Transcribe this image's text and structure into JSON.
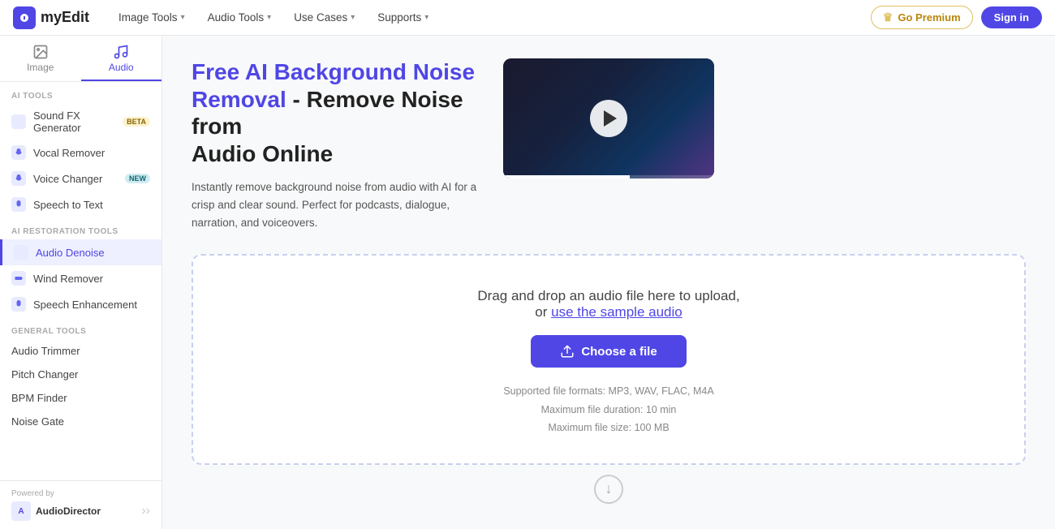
{
  "nav": {
    "logo_text": "myEdit",
    "items": [
      {
        "label": "Image Tools",
        "id": "image-tools"
      },
      {
        "label": "Audio Tools",
        "id": "audio-tools"
      },
      {
        "label": "Use Cases",
        "id": "use-cases"
      },
      {
        "label": "Supports",
        "id": "supports"
      }
    ],
    "premium_label": "Go Premium",
    "signin_label": "Sign in"
  },
  "sidebar": {
    "tab_image": "Image",
    "tab_audio": "Audio",
    "ai_tools_label": "AI TOOLS",
    "ai_restoration_label": "AI RESTORATION TOOLS",
    "general_tools_label": "GENERAL TOOLS",
    "items_ai": [
      {
        "label": "Sound FX Generator",
        "badge": "BETA",
        "badge_type": "beta"
      },
      {
        "label": "Vocal Remover",
        "badge": "",
        "badge_type": ""
      },
      {
        "label": "Voice Changer",
        "badge": "NEW",
        "badge_type": "new"
      },
      {
        "label": "Speech to Text",
        "badge": "",
        "badge_type": ""
      }
    ],
    "items_restoration": [
      {
        "label": "Audio Denoise",
        "active": true
      },
      {
        "label": "Wind Remover",
        "active": false
      },
      {
        "label": "Speech Enhancement",
        "active": false
      }
    ],
    "items_general": [
      {
        "label": "Audio Trimmer"
      },
      {
        "label": "Pitch Changer"
      },
      {
        "label": "BPM Finder"
      },
      {
        "label": "Noise Gate"
      }
    ],
    "powered_by": "Powered by",
    "powered_name": "AudioDirector"
  },
  "hero": {
    "title_line1": "Free AI Background Noise",
    "title_line2": "Removal - Remove Noise from",
    "title_line3": "Audio Online",
    "description": "Instantly remove background noise from audio with AI for a crisp and clear sound. Perfect for podcasts, dialogue, narration, and voiceovers."
  },
  "upload": {
    "drag_text": "Drag and drop an audio file here to upload,",
    "or_text": "or",
    "sample_link": "use the sample audio",
    "choose_label": "Choose a file",
    "formats_label": "Supported file formats: MP3, WAV, FLAC, M4A",
    "duration_label": "Maximum file duration: 10 min",
    "size_label": "Maximum file size: 100 MB"
  }
}
